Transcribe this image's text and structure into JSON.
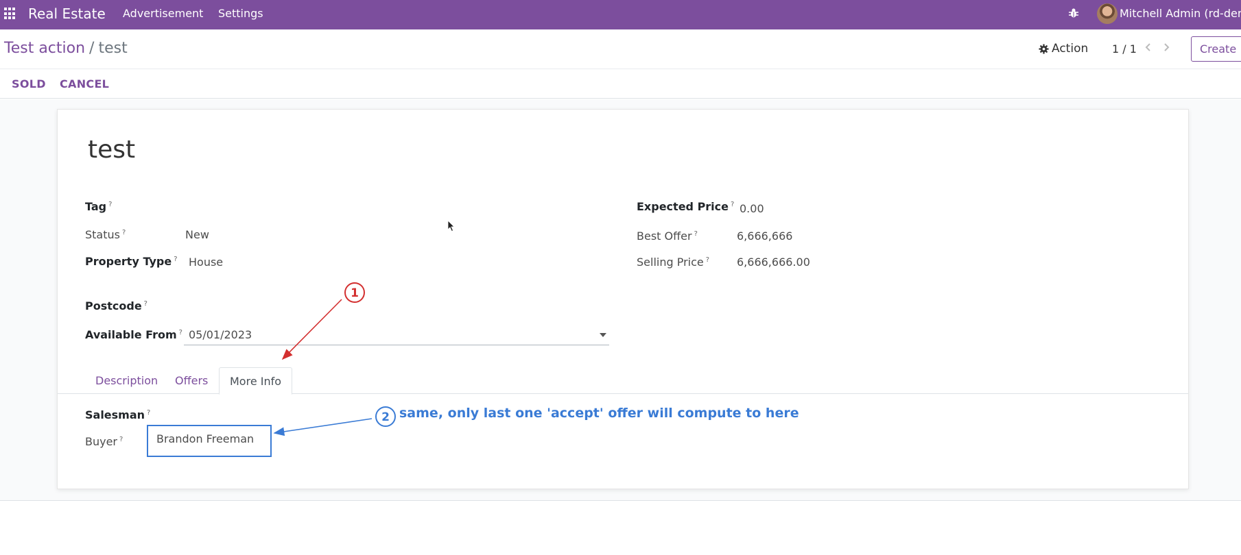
{
  "navbar": {
    "brand": "Real Estate",
    "menus": [
      "Advertisement",
      "Settings"
    ],
    "user": "Mitchell Admin (rd-demo"
  },
  "control_panel": {
    "breadcrumb_parent": "Test action",
    "breadcrumb_separator": "/",
    "breadcrumb_current": "test",
    "action_label": "Action",
    "pager": "1 / 1",
    "create_label": "Create"
  },
  "status_buttons": {
    "sold": "SOLD",
    "cancel": "CANCEL"
  },
  "form": {
    "title": "test",
    "left_fields": {
      "tag": {
        "label": "Tag",
        "value": ""
      },
      "status": {
        "label": "Status",
        "value": "New"
      },
      "property_type": {
        "label": "Property Type",
        "value": "House"
      },
      "postcode": {
        "label": "Postcode",
        "value": ""
      },
      "available_from": {
        "label": "Available From",
        "value": "05/01/2023"
      }
    },
    "right_fields": {
      "expected_price": {
        "label": "Expected Price",
        "value": "0.00"
      },
      "best_offer": {
        "label": "Best Offer",
        "value": "6,666,666"
      },
      "selling_price": {
        "label": "Selling Price",
        "value": "6,666,666.00"
      }
    },
    "help_mark": "?",
    "tabs": [
      "Description",
      "Offers",
      "More Info"
    ],
    "active_tab": "More Info",
    "more_info": {
      "salesman": {
        "label": "Salesman",
        "value": ""
      },
      "buyer": {
        "label": "Buyer",
        "value": "Brandon Freeman"
      }
    }
  },
  "annotations": {
    "marker_1": "1",
    "marker_2": "2",
    "note_2": "same, only last one 'accept' offer will compute to here",
    "color_red": "#d32f2f",
    "color_blue": "#3a7bd5"
  },
  "colors": {
    "brand_purple": "#7c4e9d",
    "page_bg": "#f9fafb"
  }
}
